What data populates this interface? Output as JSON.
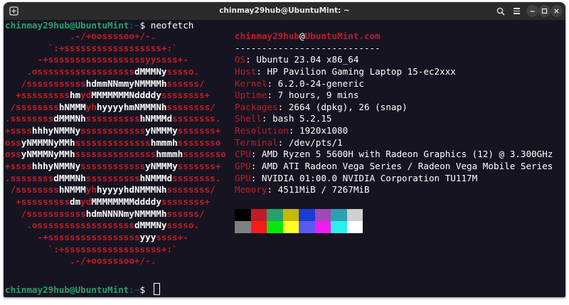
{
  "window": {
    "title": "chinmay29hub@UbuntuMint: ~"
  },
  "icons": {
    "new_tab": "new-tab-icon",
    "search": "search-icon",
    "menu": "hamburger-menu-icon",
    "minimize": "minimize-icon",
    "maximize": "maximize-icon",
    "close": "close-icon"
  },
  "prompt1": {
    "user": "chinmay29hub@UbuntuMint",
    "path": ":~",
    "symbol": "$ ",
    "command": "neofetch"
  },
  "prompt2": {
    "user": "chinmay29hub@UbuntuMint",
    "path": ":~",
    "symbol": "$ "
  },
  "logo": [
    [
      "            .-/+oossssoo+/-.",
      ""
    ],
    [
      "        `:+ssssssssssssssssss+:`",
      ""
    ],
    [
      "      -+ssssssssssssssssssyyssss+-",
      ""
    ],
    [
      "    .ossssssssssssssssss",
      "dMMMNy",
      "sssso."
    ],
    [
      "   /sssssssssss",
      "hdmmNNmmyNMMMMh",
      "ssssss/"
    ],
    [
      "  +sssssssss",
      "hm",
      "yd",
      "MMMMMMMNddddy",
      "ssssssss+"
    ],
    [
      " /ssssssss",
      "hNMMM",
      "yh",
      "hyyyyhmNMMMNh",
      "ssssssss/"
    ],
    [
      ".ssssssss",
      "dMMMNh",
      "ssssssssss",
      "hNMMMd",
      "ssssssss."
    ],
    [
      "+ssss",
      "hhhyNMMNy",
      "ssssssssssss",
      "yNMMMy",
      "sssssss+"
    ],
    [
      "oss",
      "yNMMMNyMMh",
      "ssssssssssssss",
      "hmmmh",
      "ssssssso"
    ],
    [
      "oss",
      "yNMMMNyMMh",
      "sssssssssssssss",
      "hmmmh",
      "ssssssso"
    ],
    [
      "+ssss",
      "hhhyNMMNy",
      "ssssssssssss",
      "yNMMMy",
      "sssssss+"
    ],
    [
      ".ssssssss",
      "dMMMNh",
      "ssssssssss",
      "hNMMMd",
      "ssssssss."
    ],
    [
      " /ssssssss",
      "hNMMM",
      "yh",
      "hyyyyhdNMMMNh",
      "ssssssss/"
    ],
    [
      "  +sssssssss",
      "dm",
      "yd",
      "MMMMMMMMddddy",
      "ssssssss+"
    ],
    [
      "   /sssssssssss",
      "hdmNNNNmyNMMMMh",
      "ssssss/"
    ],
    [
      "    .ossssssssssssssssss",
      "dMMMNy",
      "sssso."
    ],
    [
      "      -+sssssssssssssssss",
      "yyy",
      "ssss+-"
    ],
    [
      "        `:+ssssssssssssssssss+:`",
      ""
    ],
    [
      "            .-/+oossssoo+/-.",
      ""
    ]
  ],
  "info": {
    "user": "chinmay29hub",
    "at": "@",
    "host": "UbuntuMint.com",
    "rule": "---------------------------",
    "rows": [
      {
        "key": "OS",
        "value": "Ubuntu 23.04 x86_64"
      },
      {
        "key": "Host",
        "value": "HP Pavilion Gaming Laptop 15-ec2xxx"
      },
      {
        "key": "Kernel",
        "value": "6.2.0-24-generic"
      },
      {
        "key": "Uptime",
        "value": "7 hours, 9 mins"
      },
      {
        "key": "Packages",
        "value": "2664 (dpkg), 26 (snap)"
      },
      {
        "key": "Shell",
        "value": "bash 5.2.15"
      },
      {
        "key": "Resolution",
        "value": "1920x1080"
      },
      {
        "key": "Terminal",
        "value": "/dev/pts/1"
      },
      {
        "key": "CPU",
        "value": "AMD Ryzen 5 5600H with Radeon Graphics (12) @ 3.300GHz"
      },
      {
        "key": "GPU",
        "value": "AMD ATI Radeon Vega Series / Radeon Vega Mobile Series"
      },
      {
        "key": "GPU",
        "value": "NVIDIA 01:00.0 NVIDIA Corporation TU117M"
      },
      {
        "key": "Memory",
        "value": "4511MiB / 7267MiB"
      }
    ]
  },
  "colors": {
    "terminal_bg": "#171421",
    "accent_red": "#c01c28",
    "prompt_green": "#26a269",
    "prompt_blue": "#12488b",
    "palette_row1": [
      "#000000",
      "#c01c28",
      "#26a269",
      "#c9b800",
      "#1a3bd6",
      "#a347ba",
      "#2aa1b3",
      "#d0cfcc"
    ],
    "palette_row2": [
      "#808080",
      "#f61c1c",
      "#08e808",
      "#ffff2a",
      "#5a5af0",
      "#f01cf0",
      "#2af0f0",
      "#ffffff"
    ]
  }
}
